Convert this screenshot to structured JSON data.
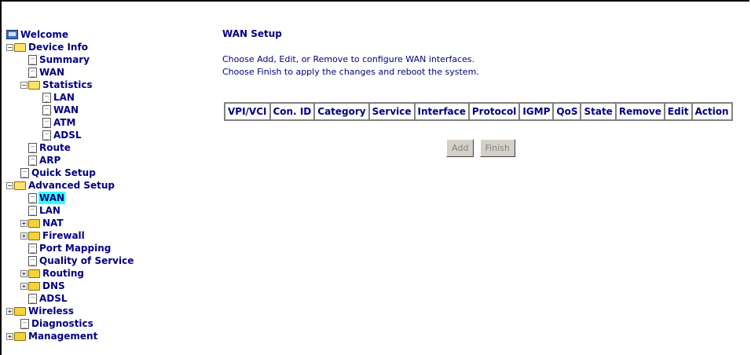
{
  "tree": {
    "welcome": "Welcome",
    "device_info": "Device Info",
    "summary": "Summary",
    "wan": "WAN",
    "statistics": "Statistics",
    "stat_lan": "LAN",
    "stat_wan": "WAN",
    "stat_atm": "ATM",
    "stat_adsl": "ADSL",
    "route": "Route",
    "arp": "ARP",
    "quick_setup": "Quick Setup",
    "advanced_setup": "Advanced Setup",
    "adv_wan": "WAN",
    "adv_lan": "LAN",
    "nat": "NAT",
    "firewall": "Firewall",
    "port_mapping": "Port Mapping",
    "qos": "Quality of Service",
    "routing": "Routing",
    "dns": "DNS",
    "adsl": "ADSL",
    "wireless": "Wireless",
    "diagnostics": "Diagnostics",
    "management": "Management"
  },
  "main": {
    "title": "WAN Setup",
    "desc_line1": "Choose Add, Edit, or Remove to configure WAN interfaces.",
    "desc_line2": "Choose Finish to apply the changes and reboot the system.",
    "columns": [
      "VPI/VCI",
      "Con. ID",
      "Category",
      "Service",
      "Interface",
      "Protocol",
      "IGMP",
      "QoS",
      "State",
      "Remove",
      "Edit",
      "Action"
    ],
    "add_label": "Add",
    "finish_label": "Finish"
  }
}
